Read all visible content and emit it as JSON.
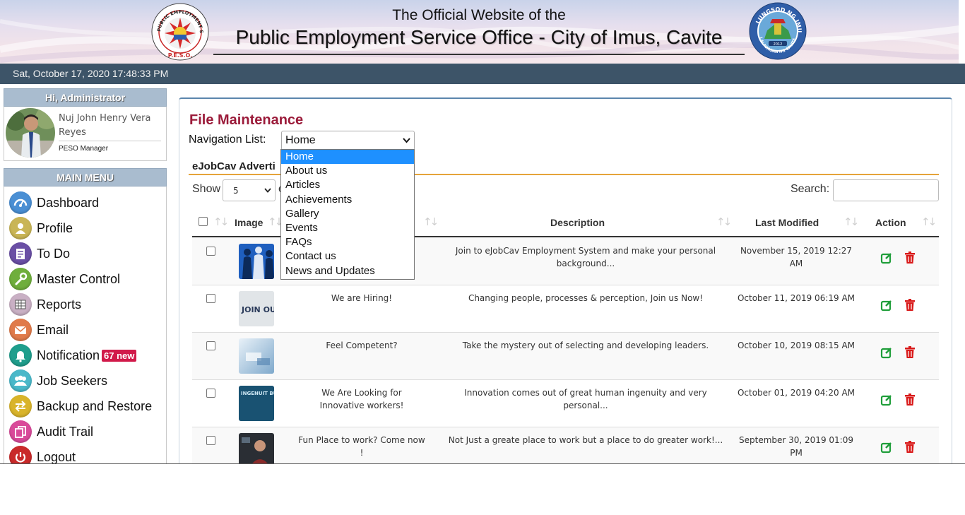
{
  "header": {
    "subtitle": "The Official Website of the",
    "title": "Public Employment Service Office - City of Imus, Cavite",
    "left_logo_text": "PUBLIC EMPLOYMENT SERVICE OFFICE · P.E.S.O.",
    "right_logo_text": "LUNGSOD NG IMUS · LALAWIGAN NG CAVITE · 2012"
  },
  "datetime": "Sat, October 17, 2020 17:48:33 PM",
  "user_panel": {
    "heading": "Hi, Administrator",
    "name": "Nuj John Henry Vera Reyes",
    "role": "PESO Manager"
  },
  "menu": {
    "heading": "MAIN MENU",
    "items": [
      {
        "label": "Dashboard",
        "icon": "dashboard-icon",
        "color": "#4a8fd4"
      },
      {
        "label": "Profile",
        "icon": "profile-icon",
        "color": "#c9b556"
      },
      {
        "label": "To Do",
        "icon": "todo-icon",
        "color": "#6a4fa5"
      },
      {
        "label": "Master Control",
        "icon": "wrench-icon",
        "color": "#6fae3c"
      },
      {
        "label": "Reports",
        "icon": "reports-icon",
        "color": "#c9b0c4"
      },
      {
        "label": "Email",
        "icon": "email-icon",
        "color": "#e07a4a"
      },
      {
        "label": "Notification",
        "icon": "bell-icon",
        "color": "#1f9e8c",
        "badge": "67 new"
      },
      {
        "label": "Job Seekers",
        "icon": "jobseekers-icon",
        "color": "#4ab8c9"
      },
      {
        "label": "Backup and Restore",
        "icon": "backup-icon",
        "color": "#d9b42a"
      },
      {
        "label": "Audit Trail",
        "icon": "audit-icon",
        "color": "#d94a9a"
      },
      {
        "label": "Logout",
        "icon": "power-icon",
        "color": "#c92a2a"
      }
    ]
  },
  "main": {
    "title": "File Maintenance",
    "nav_label": "Navigation List:",
    "nav_selected": "Home",
    "nav_options": [
      "Home",
      "About us",
      "Articles",
      "Achievements",
      "Gallery",
      "Events",
      "FAQs",
      "Contact us",
      "News and Updates"
    ],
    "section_title": "eJobCav Adverti",
    "show_label": "Show",
    "show_value": "5",
    "show_suffix": "e",
    "search_label": "Search:",
    "columns": {
      "image": "Image",
      "description": "Description",
      "last_modified": "Last Modified",
      "action": "Action"
    },
    "rows": [
      {
        "title": "",
        "description": "Join to eJobCav Employment System and make your personal background...",
        "modified": "November 15, 2019 12:27 AM",
        "thumb": "people-silhouettes"
      },
      {
        "title": "We are Hiring!",
        "description": "Changing people, processes & perception, Join us Now!",
        "modified": "October 11, 2019 06:19 AM",
        "thumb": "join-us",
        "thumb_text": "JOIN OU"
      },
      {
        "title": "Feel Competent?",
        "description": "Take the mystery out of selecting and developing leaders.",
        "modified": "October 10, 2019 08:15 AM",
        "thumb": "business-abstract"
      },
      {
        "title": "We Are Looking for Innovative workers!",
        "description": "Innovation comes out of great human ingenuity and very personal...",
        "modified": "October 01, 2019 04:20 AM",
        "thumb": "ingenuity",
        "thumb_text": "INGENUIT BUILDS CAREERS"
      },
      {
        "title": "Fun Place to work? Come now !",
        "description": "Not Just a greate place to work but a place to do greater work!...",
        "modified": "September 30, 2019 01:09 PM",
        "thumb": "office-person"
      }
    ]
  },
  "colors": {
    "accent_title": "#9b1b3a",
    "date_bar": "#3d5468",
    "section_rule": "#e5a33a",
    "edit_icon": "#1f9e3a",
    "delete_icon": "#d91a1a",
    "dropdown_selected": "#1e90ff"
  }
}
